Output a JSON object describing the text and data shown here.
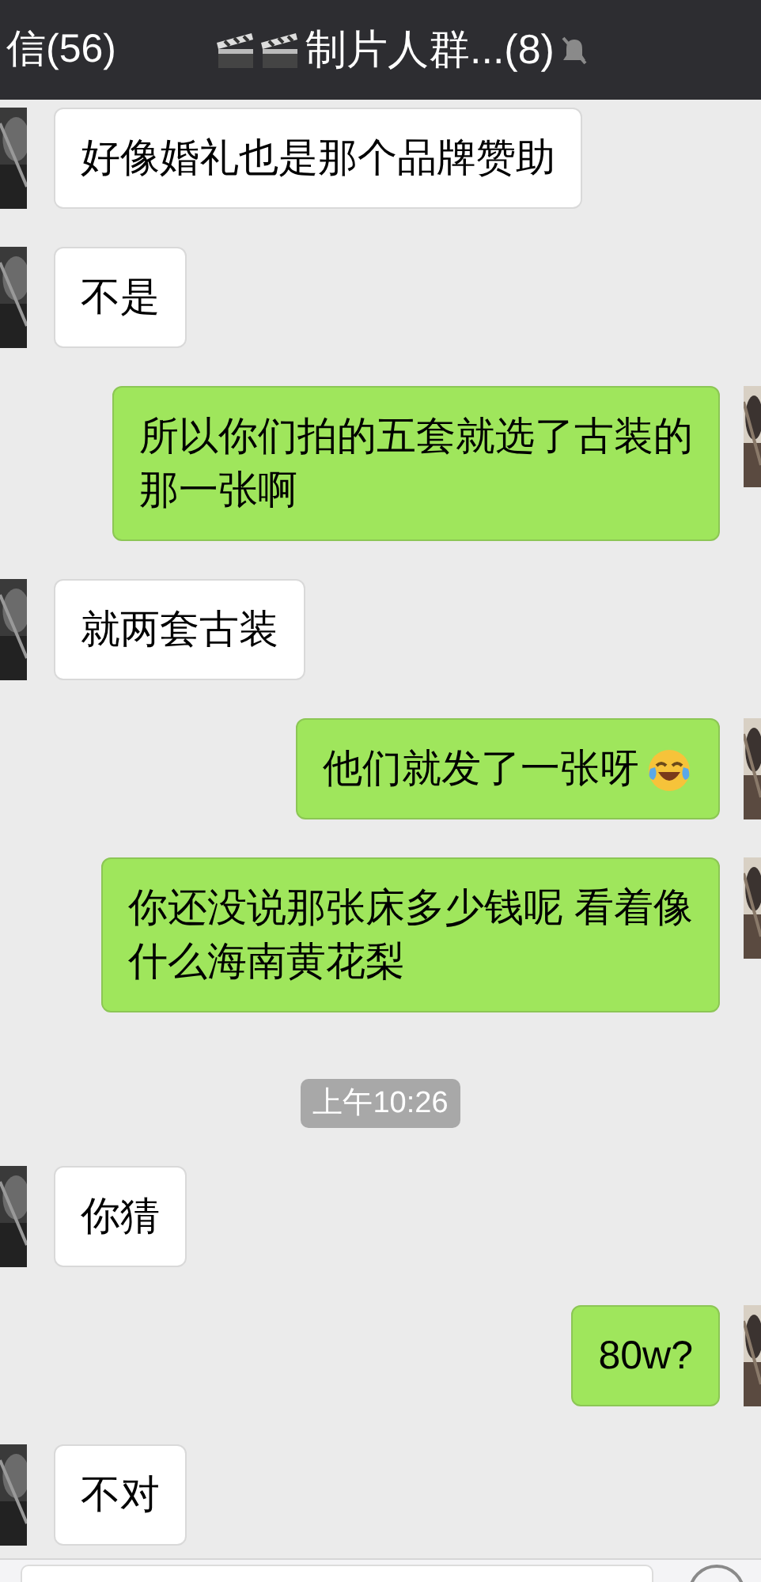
{
  "header": {
    "back_label": "信(56)",
    "title": "制片人群...(8)",
    "muted": true
  },
  "messages": [
    {
      "kind": "incoming",
      "lines": [
        "好像婚礼也是那个品牌赞助"
      ]
    },
    {
      "kind": "incoming",
      "lines": [
        "不是"
      ]
    },
    {
      "kind": "outgoing",
      "lines": [
        "所以你们拍的五套就选了古装的",
        "那一张啊"
      ]
    },
    {
      "kind": "incoming",
      "lines": [
        "就两套古装"
      ]
    },
    {
      "kind": "outgoing",
      "lines": [
        "他们就发了一张呀"
      ],
      "emoji": true
    },
    {
      "kind": "outgoing",
      "lines": [
        "你还没说那张床多少钱呢 看着像",
        "什么海南黄花梨"
      ]
    },
    {
      "kind": "time",
      "lines": [
        "上午10:26"
      ]
    },
    {
      "kind": "incoming",
      "lines": [
        "你猜"
      ]
    },
    {
      "kind": "outgoing",
      "lines": [
        "80w?"
      ]
    },
    {
      "kind": "incoming",
      "lines": [
        "不对"
      ]
    }
  ]
}
